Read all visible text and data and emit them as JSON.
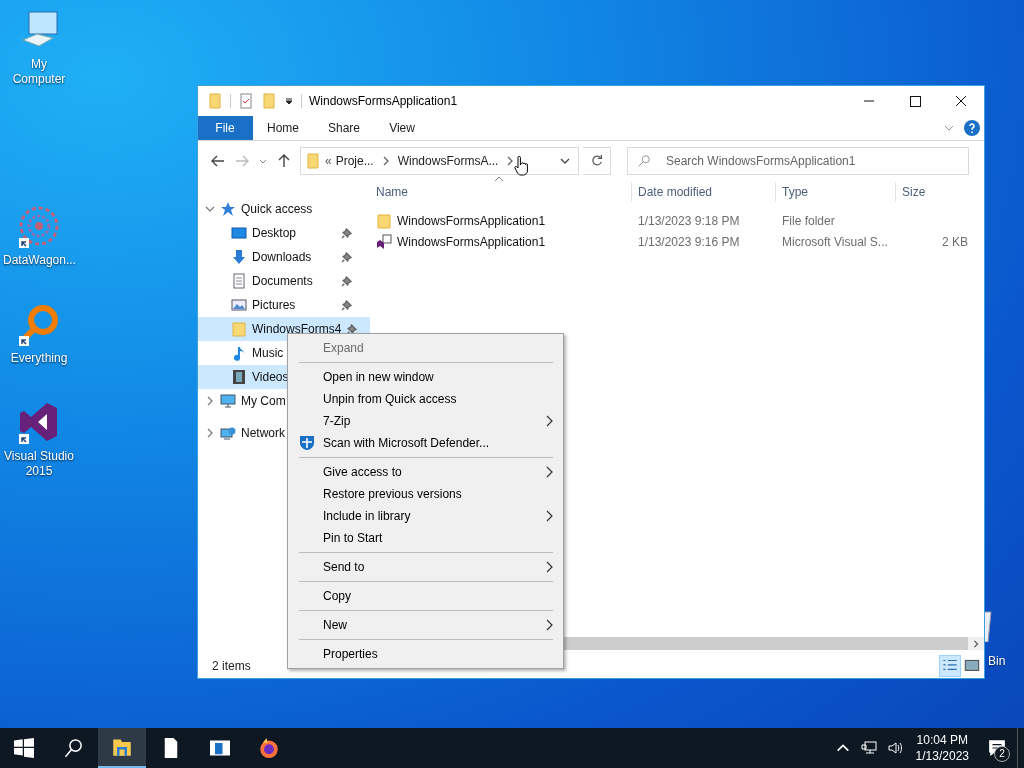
{
  "desktop_icons": [
    {
      "kind": "computer",
      "label": "My Computer",
      "shortcut": false
    },
    {
      "kind": "flower",
      "label": "DataWagon...",
      "shortcut": true
    },
    {
      "kind": "magnifier",
      "label": "Everything",
      "shortcut": true
    },
    {
      "kind": "studio",
      "label": "Visual Studio 2015",
      "shortcut": true
    },
    {
      "kind": "bin",
      "label": "Bin"
    }
  ],
  "window": {
    "title": "WindowsFormsApplication1",
    "ribbon_tabs": [
      {
        "label": "File",
        "selected": true
      },
      {
        "label": "Home",
        "selected": false
      },
      {
        "label": "Share",
        "selected": false
      },
      {
        "label": "View",
        "selected": false
      }
    ],
    "address": {
      "overflow": "«",
      "parts": [
        "Proje...",
        "WindowsFormsA..."
      ]
    },
    "search": {
      "placeholder": "Search WindowsFormsApplication1"
    },
    "nav": [
      {
        "kind": "star",
        "label": "Quick access",
        "expanded": true,
        "selected": false,
        "children": [
          {
            "kind": "desktop",
            "label": "Desktop",
            "pinned": true,
            "selected": false
          },
          {
            "kind": "downloads",
            "label": "Downloads",
            "pinned": true,
            "selected": false
          },
          {
            "kind": "documents",
            "label": "Documents",
            "pinned": true,
            "selected": false
          },
          {
            "kind": "pictures",
            "label": "Pictures",
            "pinned": true,
            "selected": false
          },
          {
            "kind": "folder",
            "label": "WindowsForms4",
            "pinned": true,
            "selected": true
          },
          {
            "kind": "music",
            "label": "Music",
            "pinned": false,
            "selected": false
          },
          {
            "kind": "videos",
            "label": "Videos",
            "pinned": false,
            "selected": true
          }
        ]
      },
      {
        "kind": "computer",
        "label": "My Com",
        "expanded": false,
        "selected": false
      },
      {
        "kind": "network",
        "label": "Network",
        "expanded": false,
        "selected": false
      }
    ],
    "columns": [
      "Name",
      "Date modified",
      "Type",
      "Size"
    ],
    "files": [
      {
        "kind": "folder",
        "name": "WindowsFormsApplication1",
        "date": "1/13/2023 9:18 PM",
        "type": "File folder"
      },
      {
        "kind": "solution",
        "name": "WindowsFormsApplication1",
        "date": "1/13/2023 9:16 PM",
        "type": "Microsoft Visual S...",
        "size": "2 KB"
      }
    ],
    "status": "2 items",
    "views": [
      {
        "kind": "details",
        "selected": true
      },
      {
        "kind": "tiles",
        "selected": false
      }
    ]
  },
  "context_menu": {
    "groups": [
      [
        {
          "label": "Expand",
          "disabled": true,
          "submenu": false,
          "has_icon": false
        }
      ],
      [
        {
          "label": "Open in new window",
          "disabled": false,
          "submenu": false,
          "has_icon": false
        },
        {
          "label": "Unpin from Quick access",
          "disabled": false,
          "submenu": false,
          "has_icon": false
        },
        {
          "label": "7-Zip",
          "disabled": false,
          "submenu": true,
          "has_icon": false
        },
        {
          "label": "Scan with Microsoft Defender...",
          "disabled": false,
          "submenu": false,
          "has_icon": true
        }
      ],
      [
        {
          "label": "Give access to",
          "disabled": false,
          "submenu": true,
          "has_icon": false
        },
        {
          "label": "Restore previous versions",
          "disabled": false,
          "submenu": false,
          "has_icon": false
        },
        {
          "label": "Include in library",
          "disabled": false,
          "submenu": true,
          "has_icon": false
        },
        {
          "label": "Pin to Start",
          "disabled": false,
          "submenu": false,
          "has_icon": false
        }
      ],
      [
        {
          "label": "Send to",
          "disabled": false,
          "submenu": true,
          "has_icon": false
        }
      ],
      [
        {
          "label": "Copy",
          "disabled": false,
          "submenu": false,
          "has_icon": false
        }
      ],
      [
        {
          "label": "New",
          "disabled": false,
          "submenu": true,
          "has_icon": false
        }
      ],
      [
        {
          "label": "Properties",
          "disabled": false,
          "submenu": false,
          "has_icon": false
        }
      ]
    ]
  },
  "taskbar": {
    "apps": [
      {
        "kind": "start",
        "active": false
      },
      {
        "kind": "search",
        "active": false
      },
      {
        "kind": "explorer",
        "active": true
      },
      {
        "kind": "notepad",
        "active": false
      },
      {
        "kind": "window",
        "active": false
      },
      {
        "kind": "firefox",
        "active": false
      }
    ],
    "time": "10:04 PM",
    "date": "1/13/2023",
    "notifications": "2"
  }
}
